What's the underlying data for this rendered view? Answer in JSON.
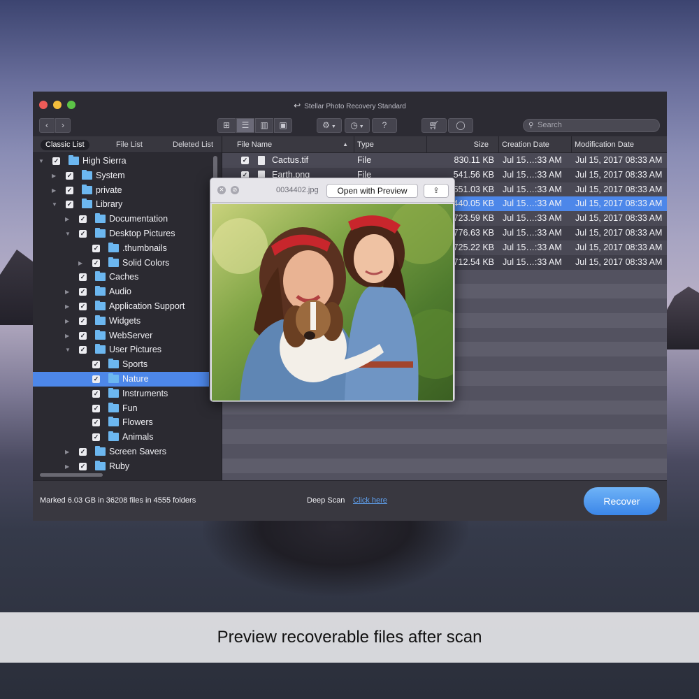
{
  "window": {
    "title": "Stellar Photo Recovery Standard"
  },
  "toolbar": {
    "nav_back_icon": "chevron-left-icon",
    "nav_forward_icon": "chevron-right-icon",
    "view_modes": [
      "grid-icon",
      "list-icon",
      "columns-icon",
      "coverflow-icon"
    ],
    "active_view": "list",
    "settings_icon": "gear-icon",
    "history_icon": "history-icon",
    "help_label": "?",
    "cart_icon": "cart-icon",
    "account_icon": "user-icon",
    "search_placeholder": "Search"
  },
  "left_panel": {
    "tabs": [
      {
        "label": "Classic List",
        "active": true
      },
      {
        "label": "File List",
        "active": false
      },
      {
        "label": "Deleted List",
        "active": false
      }
    ],
    "tree": [
      {
        "label": "High Sierra",
        "level": 0,
        "expanded": true,
        "checked": true
      },
      {
        "label": "System",
        "level": 1,
        "expanded": false,
        "checked": true
      },
      {
        "label": "private",
        "level": 1,
        "expanded": false,
        "checked": true
      },
      {
        "label": "Library",
        "level": 1,
        "expanded": true,
        "checked": true
      },
      {
        "label": "Documentation",
        "level": 2,
        "expanded": false,
        "checked": true
      },
      {
        "label": "Desktop Pictures",
        "level": 2,
        "expanded": true,
        "checked": true
      },
      {
        "label": ".thumbnails",
        "level": 3,
        "expanded": null,
        "checked": true
      },
      {
        "label": "Solid Colors",
        "level": 3,
        "expanded": false,
        "checked": true
      },
      {
        "label": "Caches",
        "level": 2,
        "expanded": null,
        "checked": true
      },
      {
        "label": "Audio",
        "level": 2,
        "expanded": false,
        "checked": true
      },
      {
        "label": "Application Support",
        "level": 2,
        "expanded": false,
        "checked": true
      },
      {
        "label": "Widgets",
        "level": 2,
        "expanded": false,
        "checked": true
      },
      {
        "label": "WebServer",
        "level": 2,
        "expanded": false,
        "checked": true
      },
      {
        "label": "User Pictures",
        "level": 2,
        "expanded": true,
        "checked": true
      },
      {
        "label": "Sports",
        "level": 3,
        "expanded": null,
        "checked": true
      },
      {
        "label": "Nature",
        "level": 3,
        "expanded": null,
        "checked": true,
        "selected": true
      },
      {
        "label": "Instruments",
        "level": 3,
        "expanded": null,
        "checked": true
      },
      {
        "label": "Fun",
        "level": 3,
        "expanded": null,
        "checked": true
      },
      {
        "label": "Flowers",
        "level": 3,
        "expanded": null,
        "checked": true
      },
      {
        "label": "Animals",
        "level": 3,
        "expanded": null,
        "checked": true
      },
      {
        "label": "Screen Savers",
        "level": 2,
        "expanded": false,
        "checked": true
      },
      {
        "label": "Ruby",
        "level": 2,
        "expanded": false,
        "checked": true
      }
    ]
  },
  "file_table": {
    "columns": [
      "File Name",
      "Type",
      "Size",
      "Creation Date",
      "Modification Date"
    ],
    "sort_column": "File Name",
    "rows": [
      {
        "name": "Cactus.tif",
        "type": "File",
        "size": "830.11 KB",
        "created": "Jul 15…:33 AM",
        "modified": "Jul 15, 2017 08:33 AM",
        "checked": true
      },
      {
        "name": "Earth.png",
        "type": "File",
        "size": "541.56 KB",
        "created": "Jul 15…:33 AM",
        "modified": "Jul 15, 2017 08:33 AM",
        "checked": true
      },
      {
        "name": "",
        "type": "",
        "size": "551.03 KB",
        "created": "Jul 15…:33 AM",
        "modified": "Jul 15, 2017 08:33 AM",
        "checked": false
      },
      {
        "name": "",
        "type": "",
        "size": "440.05 KB",
        "created": "Jul 15…:33 AM",
        "modified": "Jul 15, 2017 08:33 AM",
        "checked": false,
        "selected": true
      },
      {
        "name": "",
        "type": "",
        "size": "723.59 KB",
        "created": "Jul 15…:33 AM",
        "modified": "Jul 15, 2017 08:33 AM",
        "checked": false
      },
      {
        "name": "",
        "type": "",
        "size": "776.63 KB",
        "created": "Jul 15…:33 AM",
        "modified": "Jul 15, 2017 08:33 AM",
        "checked": false
      },
      {
        "name": "",
        "type": "",
        "size": "725.22 KB",
        "created": "Jul 15…:33 AM",
        "modified": "Jul 15, 2017 08:33 AM",
        "checked": false
      },
      {
        "name": "",
        "type": "",
        "size": "712.54 KB",
        "created": "Jul 15…:33 AM",
        "modified": "Jul 15, 2017 08:33 AM",
        "checked": false
      }
    ]
  },
  "preview": {
    "file_name": "0034402.jpg",
    "open_button": "Open with Preview",
    "share_icon": "share-icon",
    "close_icon": "close-icon",
    "fullscreen_icon": "fullscreen-icon"
  },
  "footer": {
    "status": "Marked 6.03 GB in 36208 files in 4555 folders",
    "deep_scan_label": "Deep Scan",
    "deep_scan_link": "Click here",
    "recover_button": "Recover"
  },
  "caption": "Preview recoverable files after scan",
  "colors": {
    "accent": "#4d87e9",
    "recover_button": "#4a93ee",
    "folder": "#6cb7f0",
    "window_bg": "#2f2e36"
  }
}
